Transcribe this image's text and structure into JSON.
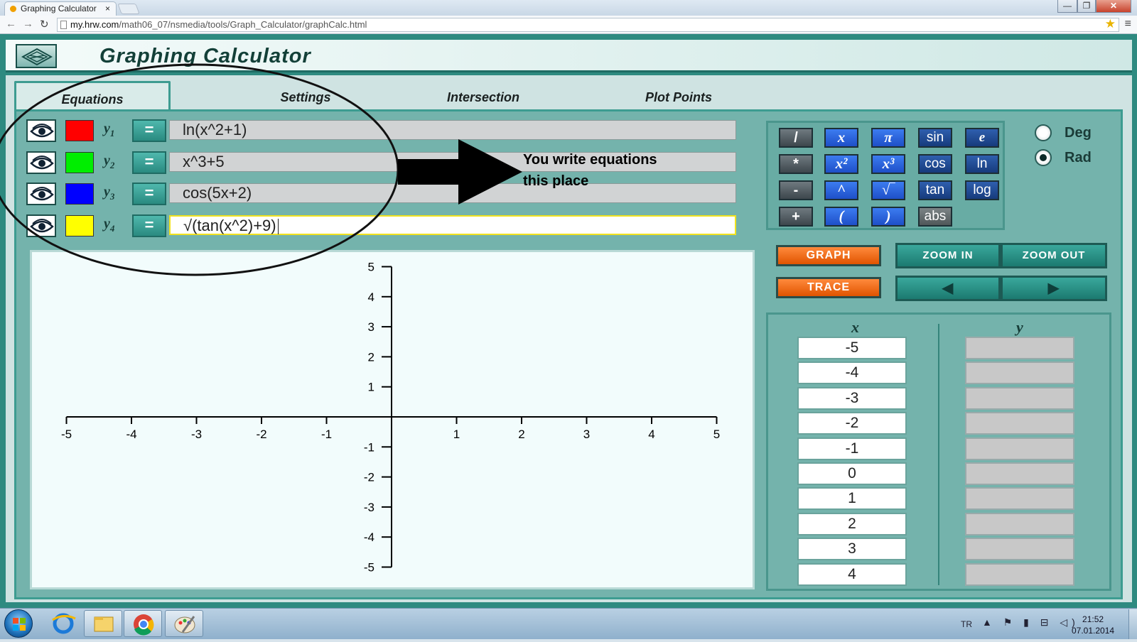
{
  "browser": {
    "tab_title": "Graphing Calculator",
    "tab_close": "×",
    "url_host": "my.hrw.com",
    "url_path": "/math06_07/nsmedia/tools/Graph_Calculator/graphCalc.html",
    "window_buttons": [
      "—",
      "❐",
      "✕"
    ]
  },
  "app": {
    "title": "Graphing Calculator",
    "tabs": [
      "Equations",
      "Settings",
      "Intersection",
      "Plot Points"
    ],
    "active_tab": "Equations"
  },
  "equations": [
    {
      "label": "y",
      "sub": "1",
      "color": "#ff0000",
      "value": "ln(x^2+1)"
    },
    {
      "label": "y",
      "sub": "2",
      "color": "#00ee00",
      "value": "x^3+5"
    },
    {
      "label": "y",
      "sub": "3",
      "color": "#0000ff",
      "value": "cos(5x+2)"
    },
    {
      "label": "y",
      "sub": "4",
      "color": "#ffff00",
      "value": "√(tan(x^2)+9)"
    }
  ],
  "equals_label": "=",
  "annotation": {
    "line1": "You write equations",
    "line2": "this place"
  },
  "chart_data": {
    "type": "line",
    "x_ticks": [
      -5,
      -4,
      -3,
      -2,
      -1,
      1,
      2,
      3,
      4,
      5
    ],
    "y_ticks": [
      5,
      4,
      3,
      2,
      1,
      -1,
      -2,
      -3,
      -4,
      -5
    ],
    "xlim": [
      -5,
      5
    ],
    "ylim": [
      -5,
      5
    ],
    "grid": false,
    "series": []
  },
  "keypad": {
    "rows": [
      [
        {
          "t": "/",
          "s": "dark"
        },
        {
          "t": "x",
          "s": "blue"
        },
        {
          "t": "π",
          "s": "blue"
        },
        {
          "t": "sin",
          "s": "navy"
        },
        {
          "t": "e",
          "s": "navy it"
        }
      ],
      [
        {
          "t": "*",
          "s": "dark"
        },
        {
          "t": "x²",
          "s": "blue"
        },
        {
          "t": "x³",
          "s": "blue"
        },
        {
          "t": "cos",
          "s": "navy"
        },
        {
          "t": "ln",
          "s": "navy"
        }
      ],
      [
        {
          "t": "-",
          "s": "dark"
        },
        {
          "t": "^",
          "s": "blue"
        },
        {
          "t": "√‾",
          "s": "blue"
        },
        {
          "t": "tan",
          "s": "navy"
        },
        {
          "t": "log",
          "s": "navy"
        }
      ],
      [
        {
          "t": "+",
          "s": "dark"
        },
        {
          "t": "(",
          "s": "blue"
        },
        {
          "t": ")",
          "s": "blue"
        },
        {
          "t": "abs",
          "s": "gray"
        }
      ]
    ]
  },
  "angle_mode": {
    "options": [
      "Deg",
      "Rad"
    ],
    "selected": "Rad"
  },
  "buttons": {
    "graph": "GRAPH",
    "trace": "TRACE",
    "zoom_in": "ZOOM IN",
    "zoom_out": "ZOOM OUT",
    "left": "◀",
    "right": "▶"
  },
  "table": {
    "x_header": "x",
    "y_header": "y",
    "x_values": [
      "-5",
      "-4",
      "-3",
      "-2",
      "-1",
      "0",
      "1",
      "2",
      "3",
      "4"
    ],
    "y_values": [
      "",
      "",
      "",
      "",
      "",
      "",
      "",
      "",
      "",
      ""
    ]
  },
  "taskbar": {
    "lang": "TR",
    "tray": "▲ ⚑ ▮ ⊟ ◁)",
    "time": "21:52",
    "date": "07.01.2014"
  }
}
